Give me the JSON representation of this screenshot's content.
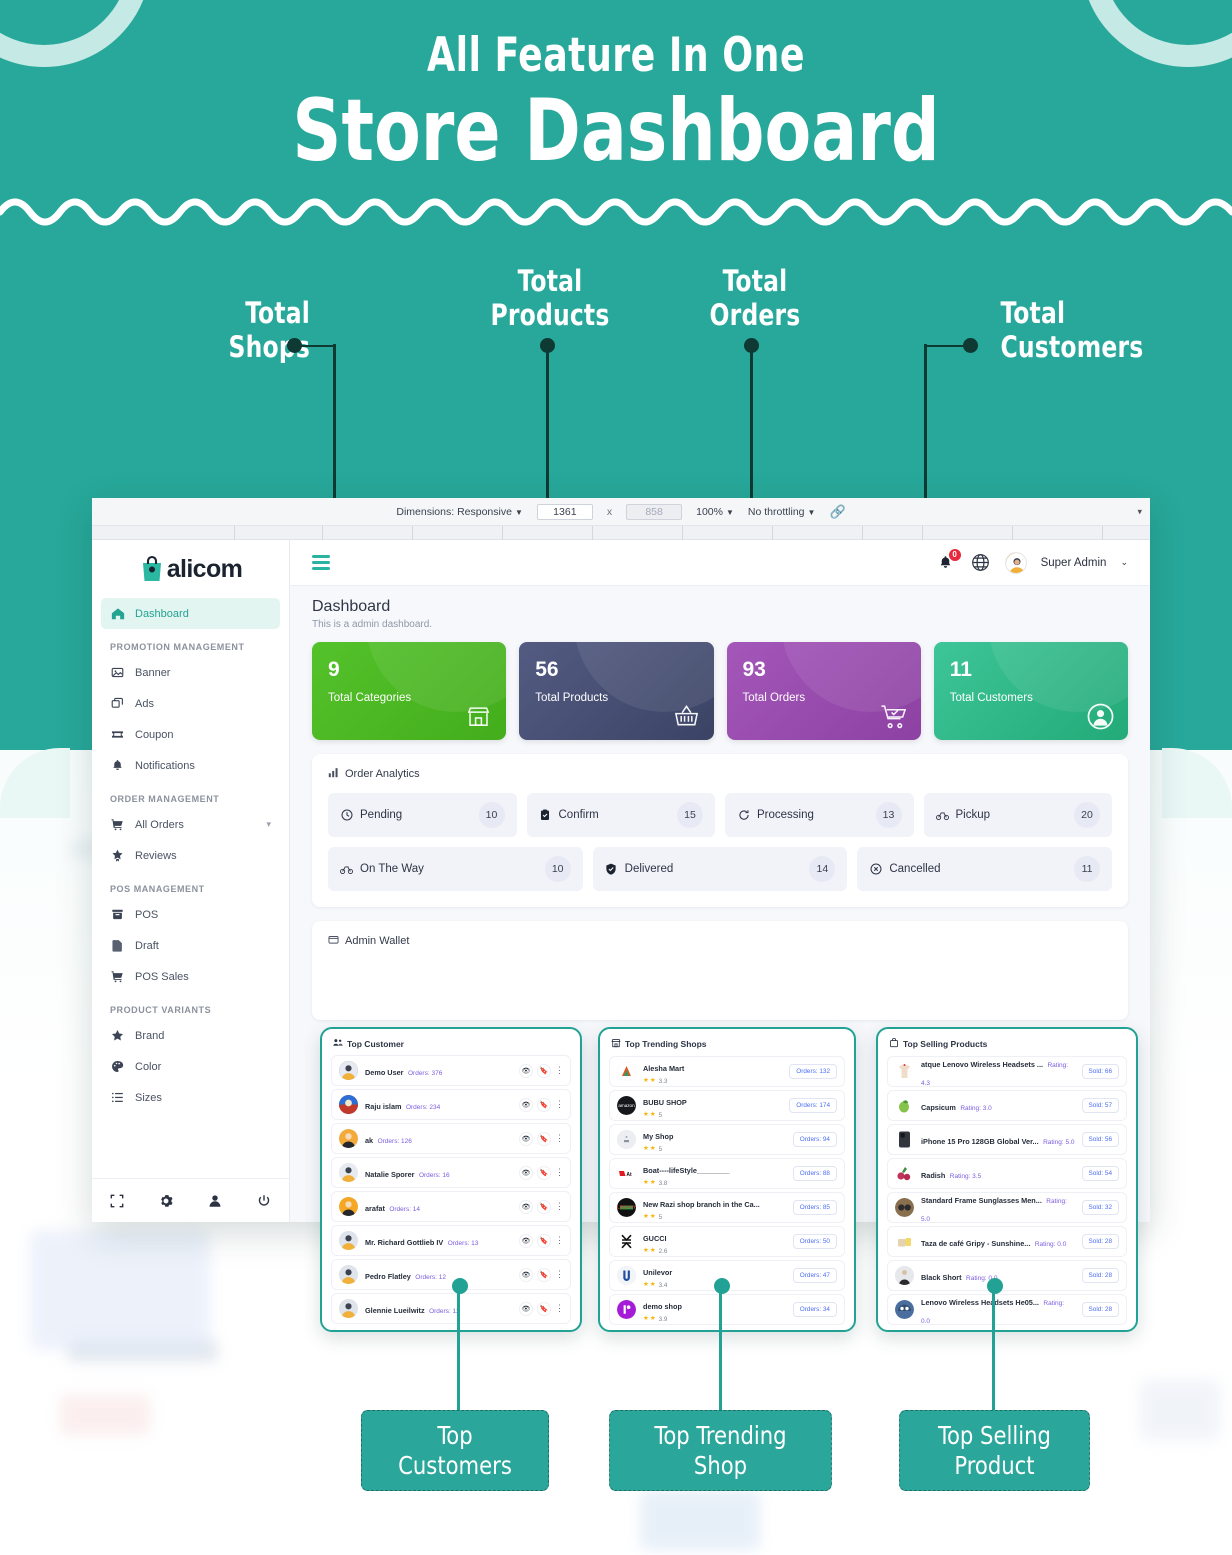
{
  "header": {
    "subtitle": "All Feature In One",
    "title": "Store Dashboard"
  },
  "callouts": {
    "shops": "Total\nShops",
    "products": "Total\nProducts",
    "orders": "Total\nOrders",
    "customers": "Total\nCustomers",
    "shops_l1": "Total",
    "shops_l2": "Shops",
    "products_l1": "Total",
    "products_l2": "Products",
    "orders_l1": "Total",
    "orders_l2": "Orders",
    "customers_l1": "Total",
    "customers_l2": "Customers"
  },
  "bottom_labels": {
    "top_customers_l1": "Top",
    "top_customers_l2": "Customers",
    "top_shop_l1": "Top Trending",
    "top_shop_l2": "Shop",
    "top_product_l1": "Top Selling",
    "top_product_l2": "Product"
  },
  "devtools": {
    "dimensions_label": "Dimensions: Responsive",
    "width": "1361",
    "times": "x",
    "height": "858",
    "zoom": "100%",
    "throttling": "No throttling",
    "caret": "▼"
  },
  "sidebar": {
    "brand": "alicom",
    "sections": [
      {
        "label": null,
        "items": [
          {
            "label": "Dashboard",
            "icon": "home-icon",
            "active": true
          }
        ]
      },
      {
        "label": "PROMOTION MANAGEMENT",
        "items": [
          {
            "label": "Banner",
            "icon": "image-icon",
            "active": false
          },
          {
            "label": "Ads",
            "icon": "ads-icon",
            "active": false
          },
          {
            "label": "Coupon",
            "icon": "ticket-icon",
            "active": false
          },
          {
            "label": "Notifications",
            "icon": "bell-icon",
            "active": false
          }
        ]
      },
      {
        "label": "ORDER MANAGEMENT",
        "items": [
          {
            "label": "All Orders",
            "icon": "cart-icon",
            "active": false,
            "chevron": "⌄"
          },
          {
            "label": "Reviews",
            "icon": "star-badge-icon",
            "active": false
          }
        ]
      },
      {
        "label": "POS MANAGEMENT",
        "items": [
          {
            "label": "POS",
            "icon": "pos-icon",
            "active": false
          },
          {
            "label": "Draft",
            "icon": "draft-icon",
            "active": false
          },
          {
            "label": "POS Sales",
            "icon": "cart-icon",
            "active": false
          }
        ]
      },
      {
        "label": "PRODUCT VARIANTS",
        "items": [
          {
            "label": "Brand",
            "icon": "star-icon",
            "active": false
          },
          {
            "label": "Color",
            "icon": "palette-icon",
            "active": false
          },
          {
            "label": "Sizes",
            "icon": "list-icon",
            "active": false
          }
        ]
      }
    ],
    "footer_icons": [
      "fullscreen-icon",
      "gear-icon",
      "user-icon",
      "power-icon"
    ]
  },
  "topbar": {
    "notification_count": "0",
    "user_name": "Super Admin",
    "caret": "⌄"
  },
  "page": {
    "title": "Dashboard",
    "subtitle": "This is a admin dashboard."
  },
  "stats": [
    {
      "value": "9",
      "label": "Total Categories",
      "color": "#4fbb26",
      "color2": "#44ae1d",
      "icon": "store-icon"
    },
    {
      "value": "56",
      "label": "Total Products",
      "color": "#4b5378",
      "color2": "#3e456a",
      "icon": "basket-icon"
    },
    {
      "value": "93",
      "label": "Total Orders",
      "color": "#9a4fb0",
      "color2": "#8e43a5",
      "icon": "cart-check-icon"
    },
    {
      "value": "11",
      "label": "Total Customers",
      "color": "#31bb8a",
      "color2": "#25ad7c",
      "icon": "user-circle-icon"
    }
  ],
  "order_analytics": {
    "title": "Order Analytics",
    "row1": [
      {
        "label": "Pending",
        "count": "10",
        "icon": "clock-icon"
      },
      {
        "label": "Confirm",
        "count": "15",
        "icon": "clipboard-check-icon"
      },
      {
        "label": "Processing",
        "count": "13",
        "icon": "refresh-icon"
      },
      {
        "label": "Pickup",
        "count": "20",
        "icon": "bike-icon"
      }
    ],
    "row2": [
      {
        "label": "On The Way",
        "count": "10",
        "icon": "bike-icon"
      },
      {
        "label": "Delivered",
        "count": "14",
        "icon": "shield-check-icon"
      },
      {
        "label": "Cancelled",
        "count": "11",
        "icon": "x-circle-icon"
      }
    ]
  },
  "admin_wallet": {
    "title": "Admin Wallet"
  },
  "top_customers": {
    "title": "Top Customer",
    "rows": [
      {
        "name": "Demo User",
        "sub": "Orders: 376",
        "av": "#6c8ab5"
      },
      {
        "name": "Raju islam",
        "sub": "Orders: 234",
        "av": "#c94f6d"
      },
      {
        "name": "ak",
        "sub": "Orders: 126",
        "av": "#f4a93b"
      },
      {
        "name": "Natalie Sporer",
        "sub": "Orders: 16",
        "av": "#8d9aa9"
      },
      {
        "name": "arafat",
        "sub": "Orders: 14",
        "av": "#f5a623"
      },
      {
        "name": "Mr. Richard Gottlieb IV",
        "sub": "Orders: 13",
        "av": "#9aa6b4"
      },
      {
        "name": "Pedro Flatley",
        "sub": "Orders: 12",
        "av": "#9aa6b4"
      },
      {
        "name": "Glennie Lueilwitz",
        "sub": "Orders: 11",
        "av": "#9aa6b4"
      }
    ],
    "actions": {
      "view": "eye-icon",
      "bookmark": "bookmark-icon",
      "more": "⋮"
    }
  },
  "top_shops": {
    "title": "Top Trending Shops",
    "rows": [
      {
        "name": "Alesha Mart",
        "rating": "3.3",
        "badge": "Orders: 132",
        "av": "#e8541f"
      },
      {
        "name": "BUBU SHOP",
        "rating": "5",
        "badge": "Orders: 174",
        "av": "#18181a"
      },
      {
        "name": "My Shop",
        "rating": "5",
        "badge": "Orders: 94",
        "av": "#eceef2"
      },
      {
        "name": "Boat----lifeStyle________",
        "rating": "3.8",
        "badge": "Orders: 88",
        "av": "#ffffff"
      },
      {
        "name": "New Razi shop branch in the Ca...",
        "rating": "5",
        "badge": "Orders: 85",
        "av": "#111111"
      },
      {
        "name": "GUCCI",
        "rating": "2.6",
        "badge": "Orders: 50",
        "av": "#ffffff"
      },
      {
        "name": "Unilevor",
        "rating": "3.4",
        "badge": "Orders: 47",
        "av": "#f2f4f8"
      },
      {
        "name": "demo shop",
        "rating": "3.9",
        "badge": "Orders: 34",
        "av": "#a41cd8"
      }
    ]
  },
  "top_products": {
    "title": "Top Selling Products",
    "rows": [
      {
        "name": "atque Lenovo Wireless Headsets ...",
        "sub": "Rating: 4.3",
        "badge": "Sold: 66",
        "av": "#eedccb"
      },
      {
        "name": "Capsicum",
        "sub": "Rating: 3.0",
        "badge": "Sold: 57",
        "av": "#7ab54a"
      },
      {
        "name": "iPhone 15 Pro 128GB Global Ver...",
        "sub": "Rating: 5.0",
        "badge": "Sold: 56",
        "av": "#33363c"
      },
      {
        "name": "Radish",
        "sub": "Rating: 3.5",
        "badge": "Sold: 54",
        "av": "#c0335b"
      },
      {
        "name": "Standard Frame Sunglasses Men...",
        "sub": "Rating: 5.0",
        "badge": "Sold: 32",
        "av": "#8a6f4e"
      },
      {
        "name": "Taza de café Gripy - Sunshine...",
        "sub": "Rating: 0.0",
        "badge": "Sold: 28",
        "av": "#e9c96c"
      },
      {
        "name": "Black Short",
        "sub": "Rating: 0.0",
        "badge": "Sold: 28",
        "av": "#2a2a2e"
      },
      {
        "name": "Lenovo Wireless Headsets He05...",
        "sub": "Rating: 0.0",
        "badge": "Sold: 28",
        "av": "#4a6f9e"
      }
    ]
  },
  "colors": {
    "brand_teal": "#27a89a",
    "pale_teal": "#e9f7f5",
    "leader_dark": "#0e3a33",
    "accent_purple": "#7b5ce0",
    "badge_blue": "#4d6ef5"
  }
}
